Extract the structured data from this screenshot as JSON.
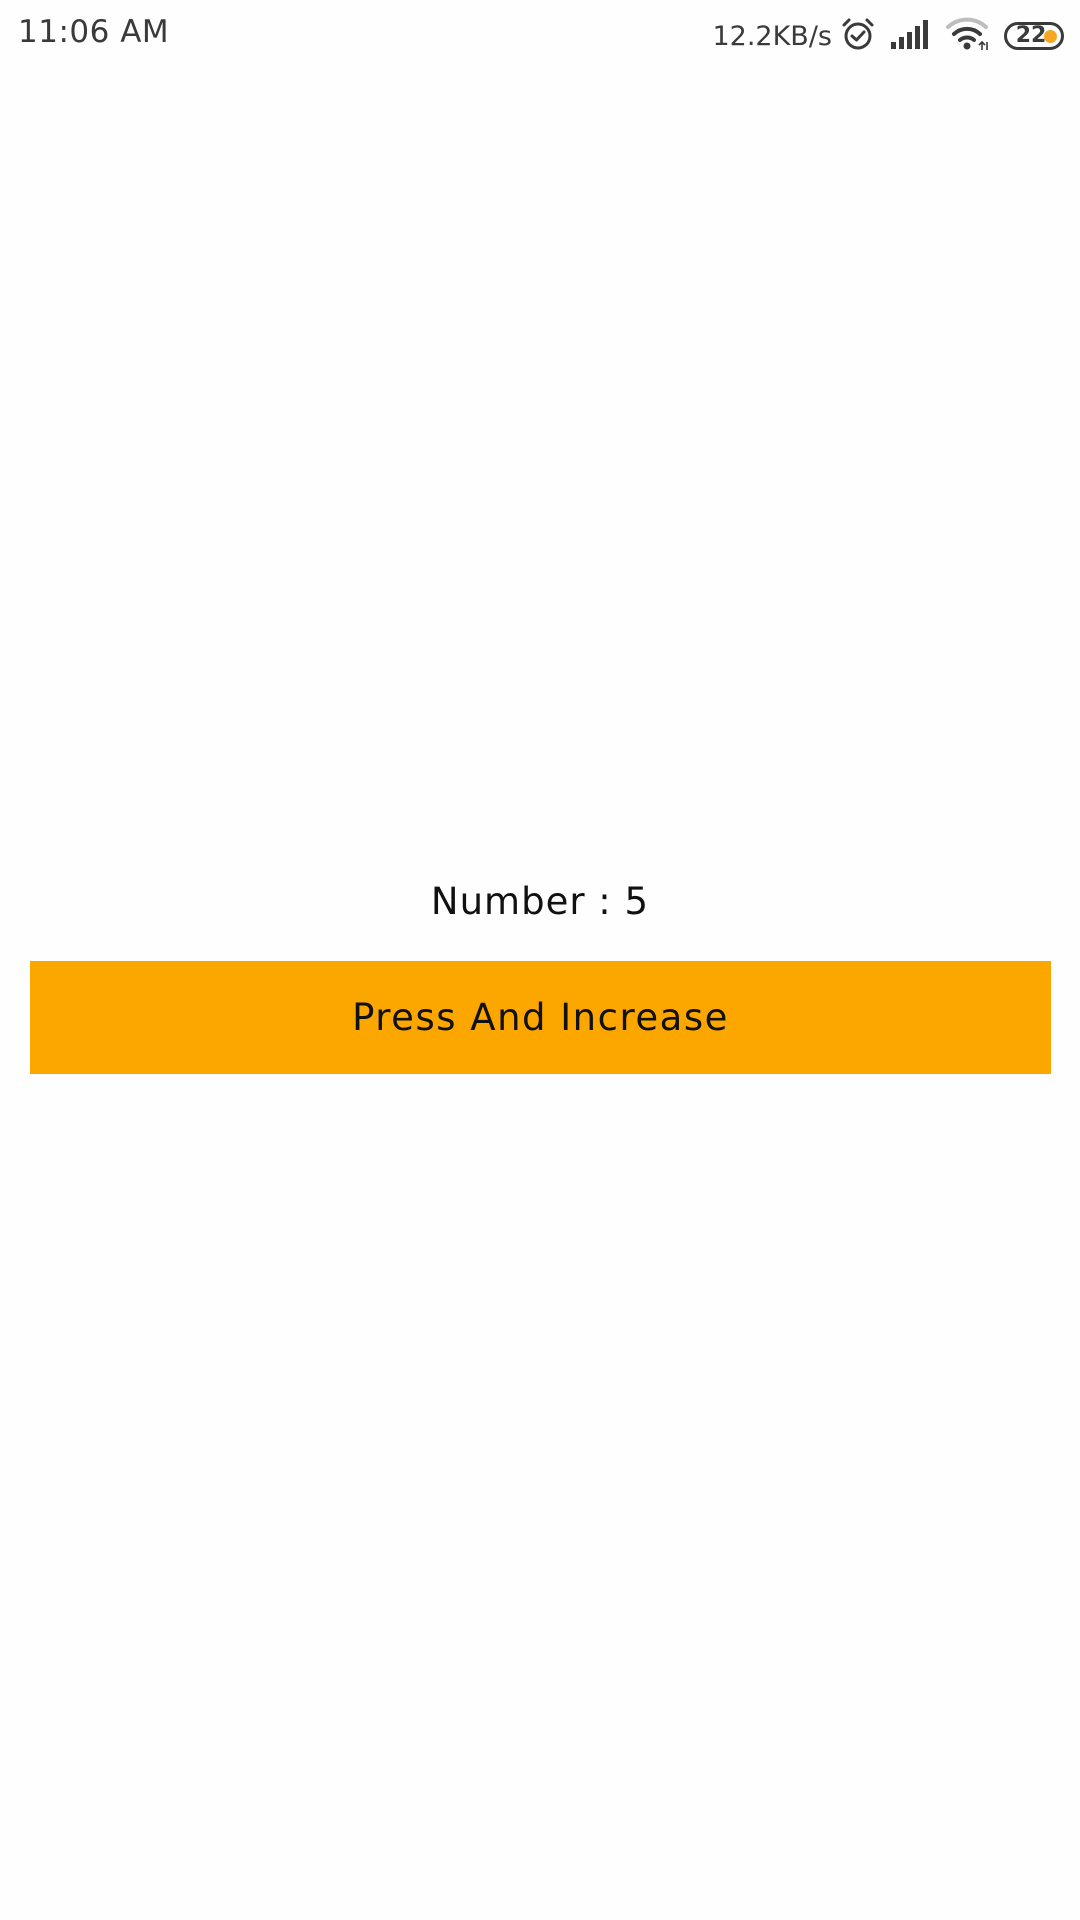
{
  "status_bar": {
    "time": "11:06 AM",
    "net_speed": "12.2KB/s",
    "icons": [
      "alarm-icon",
      "signal-icon",
      "wifi-icon",
      "battery-icon"
    ],
    "battery_level": "22",
    "battery_dot_color": "#f5a623"
  },
  "main": {
    "number_text": "Number : 5",
    "button_label": "Press And Increase",
    "button_color": "#fca600"
  }
}
